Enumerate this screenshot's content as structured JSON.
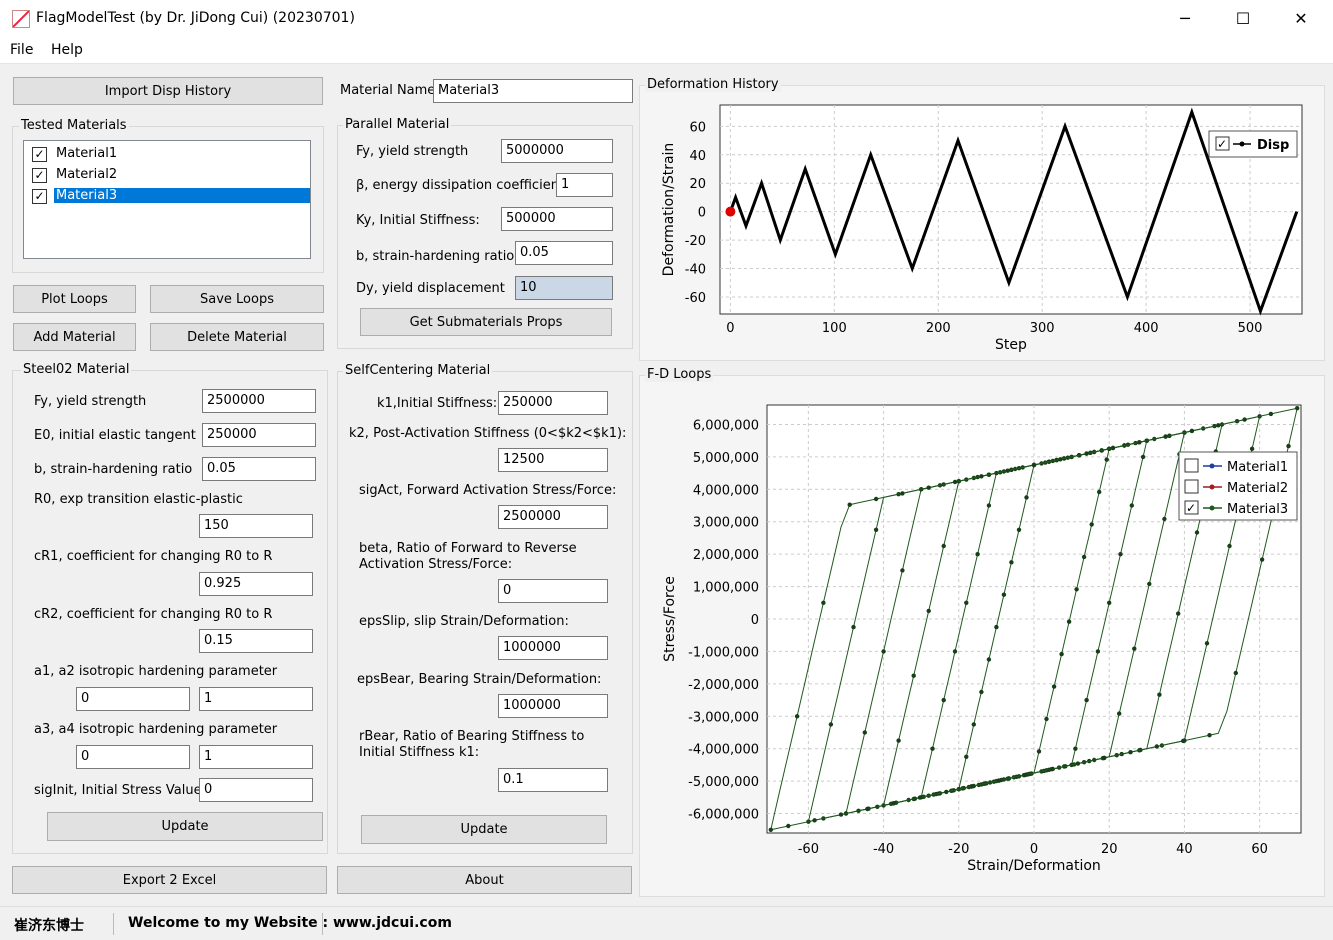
{
  "window": {
    "title": "FlagModelTest  (by Dr. JiDong Cui) (20230701)",
    "minimize": "─",
    "maximize": "☐",
    "close": "✕"
  },
  "menu": {
    "file": "File",
    "help": "Help"
  },
  "left": {
    "import_button": "Import Disp History",
    "tested_title": "Tested Materials",
    "materials": [
      {
        "name": "Material1",
        "checked": "✓"
      },
      {
        "name": "Material2",
        "checked": "✓"
      },
      {
        "name": "Material3",
        "checked": "✓"
      }
    ],
    "plot_loops": "Plot Loops",
    "save_loops": "Save Loops",
    "add_material": "Add Material",
    "delete_material": "Delete Material",
    "export_excel": "Export 2 Excel"
  },
  "steel02": {
    "title": "Steel02 Material",
    "fy_label": "Fy, yield strength",
    "fy": "2500000",
    "e0_label": "E0, initial elastic tangent",
    "e0": "250000",
    "b_label": "b, strain-hardening ratio",
    "b": "0.05",
    "r0_label": "R0, exp transition elastic-plastic",
    "r0": "150",
    "cr1_label": "cR1, coefficient for changing R0 to R",
    "cr1": "0.925",
    "cr2_label": "cR2, coefficient for changing R0 to R",
    "cr2": "0.15",
    "a12_label": "a1, a2 isotropic hardening parameter",
    "a1": "0",
    "a2": "1",
    "a34_label": "a3, a4  isotropic hardening parameter",
    "a3": "0",
    "a4": "1",
    "sig_label": "sigInit, Initial Stress Value",
    "sig": "0",
    "update": "Update"
  },
  "middle": {
    "name_label": "Material Name",
    "name_value": "Material3",
    "parallel_title": "Parallel Material",
    "p_fy_label": "Fy, yield strength",
    "p_fy": "5000000",
    "p_beta_label": "β, energy dissipation coefficient",
    "p_beta": "1",
    "p_ky_label": "Ky, Initial Stiffness:",
    "p_ky": "500000",
    "p_b_label": "b, strain-hardening ratio",
    "p_b": "0.05",
    "p_dy_label": "Dy, yield displacement",
    "p_dy": "10",
    "get_props": "Get Submaterials Props",
    "sc_title": "SelfCentering Material",
    "k1_label": "k1,Initial Stiffness:",
    "k1": "250000",
    "k2_label": "k2, Post-Activation Stiffness (0<$k2<$k1):",
    "k2": "12500",
    "sigact_label": "sigAct, Forward Activation Stress/Force:",
    "sigact": "2500000",
    "beta_label1": "beta, Ratio of Forward to Reverse",
    "beta_label2": "Activation Stress/Force:",
    "beta": "0",
    "epsslip_label": "epsSlip, slip Strain/Deformation:",
    "epsslip": "1000000",
    "epsbear_label": "epsBear, Bearing Strain/Deformation:",
    "epsbear": "1000000",
    "rbear_label1": "rBear, Ratio of Bearing Stiffness to",
    "rbear_label2": "Initial Stiffness k1:",
    "rbear": "0.1",
    "update": "Update",
    "about": "About"
  },
  "chart_data": [
    {
      "type": "line",
      "title": "Deformation History",
      "xlabel": "Step",
      "ylabel": "Deformation/Strain",
      "xlim": [
        -10,
        550
      ],
      "ylim": [
        -72,
        75
      ],
      "xticks": [
        0,
        100,
        200,
        300,
        400,
        500
      ],
      "yticks": [
        60,
        40,
        20,
        0,
        -20,
        -40,
        -60
      ],
      "grid": true,
      "legend_position": "top-right",
      "series": [
        {
          "name": "Disp",
          "checked": "✓",
          "color": "#000000",
          "marker_color": "#e00000",
          "x": [
            0,
            5,
            15,
            30,
            48,
            72,
            101,
            135,
            175,
            219,
            268,
            322,
            382,
            444,
            510,
            545
          ],
          "y": [
            0,
            10,
            -10,
            20,
            -20,
            30,
            -30,
            40,
            -40,
            50,
            -50,
            60,
            -60,
            70,
            -70,
            0
          ]
        }
      ]
    },
    {
      "type": "line",
      "title": "F-D Loops",
      "xlabel": "Strain/Deformation",
      "ylabel": "Stress/Force",
      "xlim": [
        -71,
        71
      ],
      "ylim": [
        -6600000,
        6600000
      ],
      "xticks": [
        -60,
        -40,
        -20,
        0,
        20,
        40,
        60
      ],
      "yticks": [
        "6,000,000",
        "5,000,000",
        "4,000,000",
        "3,000,000",
        "2,000,000",
        "1,000,000",
        "0",
        "-1,000,000",
        "-2,000,000",
        "-3,000,000",
        "-4,000,000",
        "-5,000,000",
        "-6,000,000"
      ],
      "grid": true,
      "legend_position": "top-right",
      "series": [
        {
          "name": "Material1",
          "checked": "",
          "color": "#1f3f9f"
        },
        {
          "name": "Material2",
          "checked": "",
          "color": "#9f1f1f"
        },
        {
          "name": "Material3",
          "checked": "✓",
          "color": "#1e5a1e"
        }
      ],
      "material3_params": {
        "Fy": 5000000,
        "Dy": 10,
        "b": 0.05,
        "beta": 1,
        "max_disp": [
          10,
          20,
          30,
          40,
          50,
          60,
          70
        ]
      }
    }
  ],
  "status": {
    "name": "崔济东博士",
    "welcome": "Welcome to my Website :",
    "url": "www.jdcui.com"
  }
}
